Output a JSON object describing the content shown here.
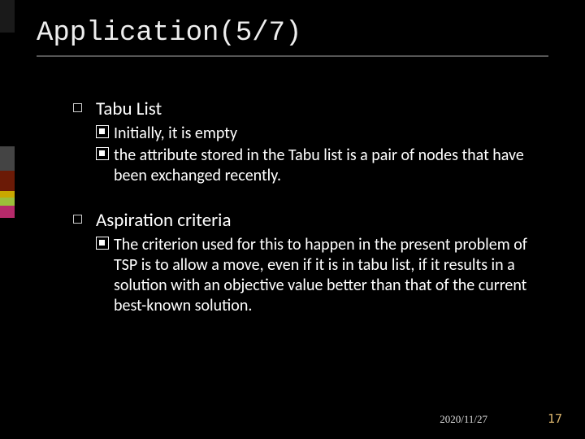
{
  "title": "Application(5/7)",
  "sections": [
    {
      "header": "Tabu List",
      "items": [
        "Initially, it is empty",
        "the attribute stored in the Tabu list is a pair of nodes that have been exchanged recently."
      ]
    },
    {
      "header": "Aspiration criteria",
      "items": [
        "The criterion used for this to happen in the present problem of TSP is to allow a move, even if it is in tabu list, if it results in a solution with an objective value better than that of the current best-known solution."
      ]
    }
  ],
  "footer": {
    "date": "2020/11/27",
    "page": "17"
  }
}
